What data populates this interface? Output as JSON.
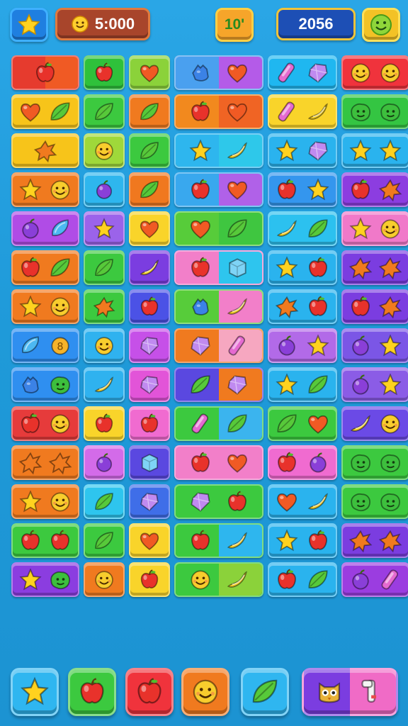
{
  "hud": {
    "coins_value": "5:000",
    "moves_value": "10'",
    "score_value": "2056",
    "menu_icon": "star-icon",
    "coin_icon": "smiley-coin-icon",
    "face_icon": "smiley-icon"
  },
  "board": {
    "columns": 6,
    "rows": 14,
    "tiles": [
      [
        {
          "bg": [
            "#e63b2e",
            "#f05a24"
          ],
          "icons": [
            "apple"
          ]
        },
        {
          "bg": [
            "#2fc13b"
          ],
          "icons": [
            "apple"
          ]
        },
        {
          "bg": [
            "#8bd23a"
          ],
          "icons": [
            "heart"
          ]
        },
        {
          "bg": [
            "#4aa0ef",
            "#b45be8"
          ],
          "icons": [
            "hand",
            "heart"
          ]
        },
        {
          "bg": [
            "#1fb7f0"
          ],
          "icons": [
            "candy",
            "gem"
          ]
        },
        {
          "bg": [
            "#f0333c"
          ],
          "icons": [
            "face",
            "face"
          ]
        }
      ],
      [
        {
          "bg": [
            "#f7c41a"
          ],
          "icons": [
            "heart",
            "leaf"
          ]
        },
        {
          "bg": [
            "#3cc93f"
          ],
          "icons": [
            "leaf"
          ]
        },
        {
          "bg": [
            "#f07a1f"
          ],
          "icons": [
            "leaf"
          ]
        },
        {
          "bg": [
            "#f2891e",
            "#f06424"
          ],
          "icons": [
            "apple",
            "heart"
          ]
        },
        {
          "bg": [
            "#f9d42a"
          ],
          "icons": [
            "candy",
            "banana"
          ]
        },
        {
          "bg": [
            "#34c542"
          ],
          "icons": [
            "blob",
            "blob"
          ]
        }
      ],
      [
        {
          "bg": [
            "#f7c41a"
          ],
          "icons": [
            "splat"
          ]
        },
        {
          "bg": [
            "#9fd83a"
          ],
          "icons": [
            "face"
          ]
        },
        {
          "bg": [
            "#3cc93f"
          ],
          "icons": [
            "leaf"
          ]
        },
        {
          "bg": [
            "#2eb6ee",
            "#2ec8ea"
          ],
          "icons": [
            "star",
            "banana"
          ]
        },
        {
          "bg": [
            "#2ab3ee"
          ],
          "icons": [
            "star",
            "gem"
          ]
        },
        {
          "bg": [
            "#2ab3ee"
          ],
          "icons": [
            "star",
            "star"
          ]
        }
      ],
      [
        {
          "bg": [
            "#f07a1f"
          ],
          "icons": [
            "star",
            "face"
          ]
        },
        {
          "bg": [
            "#2eb6ee"
          ],
          "icons": [
            "plum"
          ]
        },
        {
          "bg": [
            "#f0781f"
          ],
          "icons": [
            "leaf"
          ]
        },
        {
          "bg": [
            "#39a8ee",
            "#b061e8"
          ],
          "icons": [
            "apple",
            "heart"
          ]
        },
        {
          "bg": [
            "#3496ee"
          ],
          "icons": [
            "apple",
            "star"
          ]
        },
        {
          "bg": [
            "#8c3de0"
          ],
          "icons": [
            "apple",
            "splat"
          ]
        }
      ],
      [
        {
          "bg": [
            "#b04ce6"
          ],
          "icons": [
            "plum",
            "drop"
          ]
        },
        {
          "bg": [
            "#9b63ea"
          ],
          "icons": [
            "star"
          ]
        },
        {
          "bg": [
            "#f9d42a"
          ],
          "icons": [
            "heart"
          ]
        },
        {
          "bg": [
            "#57cc3a",
            "#3fc640"
          ],
          "icons": [
            "heart",
            "leaf"
          ]
        },
        {
          "bg": [
            "#2cc1ef"
          ],
          "icons": [
            "banana",
            "leaf"
          ]
        },
        {
          "bg": [
            "#f079c9"
          ],
          "icons": [
            "star",
            "face"
          ]
        }
      ],
      [
        {
          "bg": [
            "#f07a1f"
          ],
          "icons": [
            "apple",
            "leaf"
          ]
        },
        {
          "bg": [
            "#3cc93f"
          ],
          "icons": [
            "leaf"
          ]
        },
        {
          "bg": [
            "#7b3de0"
          ],
          "icons": [
            "banana"
          ]
        },
        {
          "bg": [
            "#f27fc9",
            "#2ec5ee"
          ],
          "icons": [
            "apple",
            "cube"
          ]
        },
        {
          "bg": [
            "#2ab3ee"
          ],
          "icons": [
            "star",
            "apple"
          ]
        },
        {
          "bg": [
            "#7b3de0"
          ],
          "icons": [
            "splat",
            "splat"
          ]
        }
      ],
      [
        {
          "bg": [
            "#f07a1f"
          ],
          "icons": [
            "star",
            "face"
          ]
        },
        {
          "bg": [
            "#3cc93f"
          ],
          "icons": [
            "splat"
          ]
        },
        {
          "bg": [
            "#4b52e6"
          ],
          "icons": [
            "apple"
          ]
        },
        {
          "bg": [
            "#57cc3a",
            "#f27fc9"
          ],
          "icons": [
            "hand",
            "banana"
          ]
        },
        {
          "bg": [
            "#2ab3ee"
          ],
          "icons": [
            "splat",
            "apple"
          ]
        },
        {
          "bg": [
            "#7b3de0"
          ],
          "icons": [
            "apple",
            "splat"
          ]
        }
      ],
      [
        {
          "bg": [
            "#2f8ff0"
          ],
          "icons": [
            "drop",
            "coin"
          ]
        },
        {
          "bg": [
            "#2fb2ef"
          ],
          "icons": [
            "face"
          ]
        },
        {
          "bg": [
            "#c650e8"
          ],
          "icons": [
            "gem"
          ]
        },
        {
          "bg": [
            "#f07a1f",
            "#f6a7c0"
          ],
          "icons": [
            "gem",
            "candy"
          ]
        },
        {
          "bg": [
            "#b26ae8"
          ],
          "icons": [
            "plum",
            "star"
          ]
        },
        {
          "bg": [
            "#7b56e6"
          ],
          "icons": [
            "plum",
            "star"
          ]
        }
      ],
      [
        {
          "bg": [
            "#2f8ff0"
          ],
          "icons": [
            "hand",
            "blob"
          ]
        },
        {
          "bg": [
            "#2fb2ef"
          ],
          "icons": [
            "banana"
          ]
        },
        {
          "bg": [
            "#e254d8"
          ],
          "icons": [
            "gem"
          ]
        },
        {
          "bg": [
            "#5a48e0",
            "#f07a1f"
          ],
          "icons": [
            "leaf",
            "gem"
          ]
        },
        {
          "bg": [
            "#2ab3ee"
          ],
          "icons": [
            "star",
            "leaf"
          ]
        },
        {
          "bg": [
            "#8b5ce6"
          ],
          "icons": [
            "plum",
            "star"
          ]
        }
      ],
      [
        {
          "bg": [
            "#e63b3b"
          ],
          "icons": [
            "apple",
            "face"
          ]
        },
        {
          "bg": [
            "#f9d42a"
          ],
          "icons": [
            "apple"
          ]
        },
        {
          "bg": [
            "#f06bd0"
          ],
          "icons": [
            "apple"
          ]
        },
        {
          "bg": [
            "#3cc93f",
            "#3bb4ee"
          ],
          "icons": [
            "candy",
            "leaf"
          ]
        },
        {
          "bg": [
            "#3cc93f"
          ],
          "icons": [
            "leaf",
            "heart"
          ]
        },
        {
          "bg": [
            "#6b4ae6"
          ],
          "icons": [
            "banana",
            "face"
          ]
        }
      ],
      [
        {
          "bg": [
            "#f07a1f"
          ],
          "icons": [
            "splat",
            "splat"
          ]
        },
        {
          "bg": [
            "#d36be9"
          ],
          "icons": [
            "plum"
          ]
        },
        {
          "bg": [
            "#5a48e0"
          ],
          "icons": [
            "cube"
          ]
        },
        {
          "bg": [
            "#f27fc9",
            "#f27fc9"
          ],
          "icons": [
            "apple",
            "heart"
          ]
        },
        {
          "bg": [
            "#f06bd0"
          ],
          "icons": [
            "apple",
            "plum"
          ]
        },
        {
          "bg": [
            "#3cc93f"
          ],
          "icons": [
            "blob",
            "blob"
          ]
        }
      ],
      [
        {
          "bg": [
            "#f07a1f"
          ],
          "icons": [
            "star",
            "face"
          ]
        },
        {
          "bg": [
            "#2ec5ee"
          ],
          "icons": [
            "leaf"
          ]
        },
        {
          "bg": [
            "#3f6ee8"
          ],
          "icons": [
            "gem"
          ]
        },
        {
          "bg": [
            "#3cc93f",
            "#3cc93f"
          ],
          "icons": [
            "gem",
            "apple"
          ]
        },
        {
          "bg": [
            "#2ab3ee"
          ],
          "icons": [
            "heart",
            "banana"
          ]
        },
        {
          "bg": [
            "#3cc93f"
          ],
          "icons": [
            "blob",
            "blob"
          ]
        }
      ],
      [
        {
          "bg": [
            "#3cc93f"
          ],
          "icons": [
            "apple",
            "apple"
          ]
        },
        {
          "bg": [
            "#3cc93f"
          ],
          "icons": [
            "leaf"
          ]
        },
        {
          "bg": [
            "#f9d42a"
          ],
          "icons": [
            "heart"
          ]
        },
        {
          "bg": [
            "#3cc93f",
            "#2eb6ee"
          ],
          "icons": [
            "apple",
            "banana"
          ]
        },
        {
          "bg": [
            "#2ab3ee"
          ],
          "icons": [
            "star",
            "apple"
          ]
        },
        {
          "bg": [
            "#7b3de0"
          ],
          "icons": [
            "splat",
            "splat"
          ]
        }
      ],
      [
        {
          "bg": [
            "#8b3de0"
          ],
          "icons": [
            "star",
            "blob"
          ]
        },
        {
          "bg": [
            "#f07a1f"
          ],
          "icons": [
            "face"
          ]
        },
        {
          "bg": [
            "#f9d42a"
          ],
          "icons": [
            "apple"
          ]
        },
        {
          "bg": [
            "#3cc93f",
            "#8bd23a"
          ],
          "icons": [
            "face",
            "banana"
          ]
        },
        {
          "bg": [
            "#2ab3ee"
          ],
          "icons": [
            "apple",
            "leaf"
          ]
        },
        {
          "bg": [
            "#9b3de0"
          ],
          "icons": [
            "plum",
            "candy"
          ]
        }
      ]
    ]
  },
  "tray": {
    "items": [
      {
        "name": "tray-slot-1",
        "bg": "#2fb6f0",
        "icon": "star"
      },
      {
        "name": "tray-slot-2",
        "bg": "#3cc93f",
        "icon": "apple"
      },
      {
        "name": "tray-slot-3",
        "bg": "#f0333c",
        "icon": "apple"
      },
      {
        "name": "tray-slot-4",
        "bg": "#f07a1f",
        "icon": "face"
      },
      {
        "name": "tray-slot-5",
        "bg": "#2fb6f0",
        "icon": "leaf"
      }
    ],
    "booster": {
      "bg": [
        "#7b3de0",
        "#f06bc6"
      ],
      "icons": [
        "owl",
        "key"
      ]
    }
  },
  "icon_colors": {
    "apple": "#e8322b",
    "heart": "#f05a24",
    "leaf": "#57c93a",
    "banana": "#f6d22a",
    "star": "#ffd21f",
    "plum": "#8a3fd8",
    "face": "#f8cd2d",
    "splat": "#f07a1f",
    "drop": "#4cb8f2",
    "gem": "#c08af0",
    "candy": "#e56ad0",
    "hand": "#3b82e6",
    "blob": "#3dbf3d",
    "cube": "#7ed4f6",
    "coin": "#f6b32a",
    "owl": "#e8b23a",
    "key": "#f4f4f4"
  }
}
